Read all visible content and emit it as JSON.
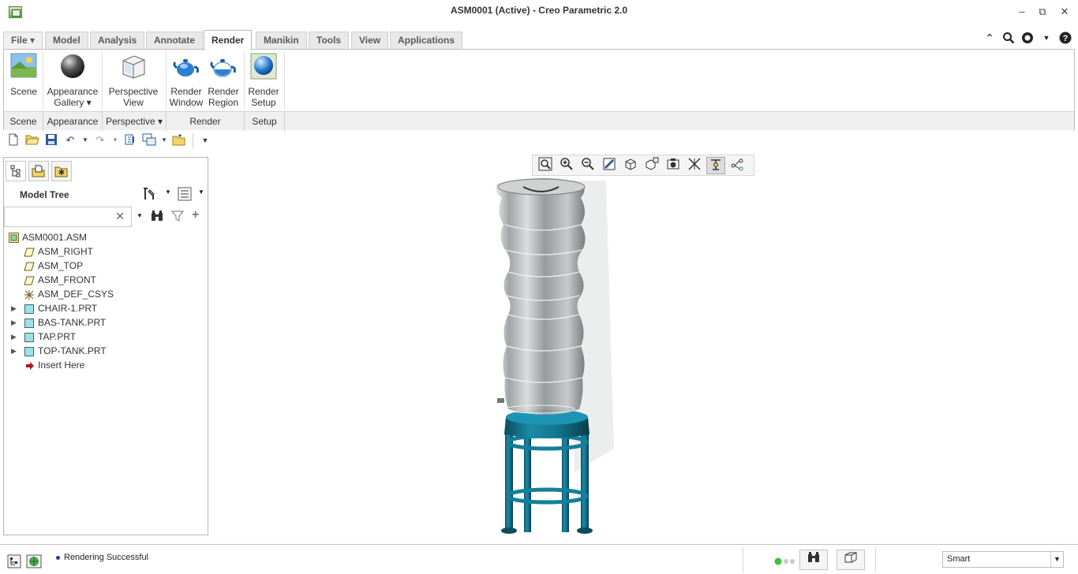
{
  "window": {
    "title": "ASM0001 (Active) - Creo Parametric 2.0",
    "app_icon": "creo-app-icon",
    "controls": [
      "minimize-icon",
      "restore-icon",
      "close-icon"
    ]
  },
  "tabs": [
    {
      "label": "File ▾",
      "active": false
    },
    {
      "label": "Model",
      "active": false
    },
    {
      "label": "Analysis",
      "active": false
    },
    {
      "label": "Annotate",
      "active": false
    },
    {
      "label": "Render",
      "active": true
    },
    {
      "label": "Manikin",
      "active": false
    },
    {
      "label": "Tools",
      "active": false
    },
    {
      "label": "View",
      "active": false
    },
    {
      "label": "Applications",
      "active": false
    }
  ],
  "ribbon": {
    "buttons": [
      {
        "line1": "Scene",
        "line2": ""
      },
      {
        "line1": "Appearance",
        "line2": "Gallery ▾"
      },
      {
        "line1": "Perspective",
        "line2": "View"
      },
      {
        "line1": "Render",
        "line2": "Window"
      },
      {
        "line1": "Render",
        "line2": "Region"
      },
      {
        "line1": "Render",
        "line2": "Setup"
      }
    ],
    "groups": [
      "Scene",
      "Appearance",
      "Perspective ▾",
      "Render",
      "Setup"
    ]
  },
  "model_tree": {
    "title": "Model Tree",
    "search_placeholder": "",
    "items": [
      {
        "label": "ASM0001.ASM",
        "icon": "assembly-icon",
        "expandable": false,
        "level": 0
      },
      {
        "label": "ASM_RIGHT",
        "icon": "datum-plane-icon",
        "expandable": false,
        "level": 1
      },
      {
        "label": "ASM_TOP",
        "icon": "datum-plane-icon",
        "expandable": false,
        "level": 1
      },
      {
        "label": "ASM_FRONT",
        "icon": "datum-plane-icon",
        "expandable": false,
        "level": 1
      },
      {
        "label": "ASM_DEF_CSYS",
        "icon": "csys-icon",
        "expandable": false,
        "level": 1
      },
      {
        "label": "CHAIR-1.PRT",
        "icon": "part-icon",
        "expandable": true,
        "level": 1
      },
      {
        "label": "BAS-TANK.PRT",
        "icon": "part-icon",
        "expandable": true,
        "level": 1
      },
      {
        "label": "TAP.PRT",
        "icon": "part-icon",
        "expandable": true,
        "level": 1
      },
      {
        "label": "TOP-TANK.PRT",
        "icon": "part-icon",
        "expandable": true,
        "level": 1
      },
      {
        "label": "Insert Here",
        "icon": "insert-arrow-icon",
        "expandable": false,
        "level": 1
      }
    ]
  },
  "status": {
    "message": "Rendering Successful",
    "filter_value": "Smart"
  },
  "colors": {
    "stand": "#1a7a96",
    "bottle": "#b9bcbd",
    "tab_active": "#ffffff"
  }
}
